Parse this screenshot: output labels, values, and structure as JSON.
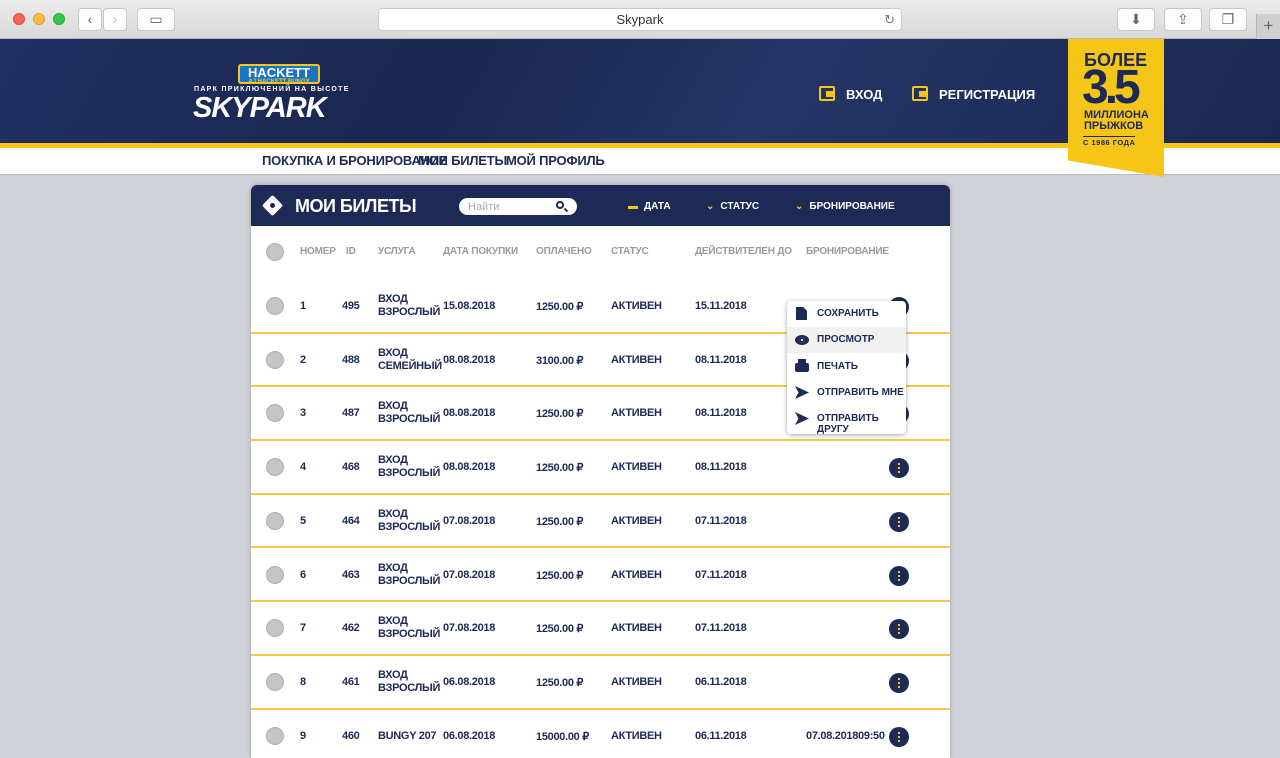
{
  "browser": {
    "tab_title": "Skypark"
  },
  "site": {
    "logo_badge_top": "HACKETT",
    "logo_badge_sub": "AJ HACKETT BUNGY",
    "logo_tagline": "ПАРК ПРИКЛЮЧЕНИЙ НА ВЫСОТЕ",
    "logo_name": "SKYPARK",
    "login_label": "ВХОД",
    "register_label": "РЕГИСТРАЦИЯ",
    "promo": {
      "line1": "БОЛЕЕ",
      "number": "3.5",
      "line2": "МИЛЛИОНА",
      "line3": "ПРЫЖКОВ",
      "line4": "С 1986 ГОДА"
    },
    "nav": [
      "ПОКУПКА И БРОНИРОВАНИЕ",
      "МОИ БИЛЕТЫ",
      "МОЙ ПРОФИЛЬ"
    ]
  },
  "panel": {
    "title": "МОИ БИЛЕТЫ",
    "search_placeholder": "Найти",
    "filters": [
      "ДАТА",
      "СТАТУС",
      "БРОНИРОВАНИЕ"
    ],
    "columns": [
      "НОМЕР",
      "ID",
      "УСЛУГА",
      "ДАТА ПОКУПКИ",
      "ОПЛАЧЕНО",
      "СТАТУС",
      "ДЕЙСТВИТЕЛЕН ДО",
      "БРОНИРОВАНИЕ"
    ],
    "rows": [
      {
        "num": "1",
        "id": "495",
        "service1": "ВХОД",
        "service2": "ВЗРОСЛЫЙ",
        "purchase_date": "15.08.2018",
        "paid": "1250.00 ₽",
        "status": "АКТИВЕН",
        "valid_until": "15.11.2018",
        "booking": ""
      },
      {
        "num": "2",
        "id": "488",
        "service1": "ВХОД",
        "service2": "СЕМЕЙНЫЙ",
        "purchase_date": "08.08.2018",
        "paid": "3100.00 ₽",
        "status": "АКТИВЕН",
        "valid_until": "08.11.2018",
        "booking": ""
      },
      {
        "num": "3",
        "id": "487",
        "service1": "ВХОД",
        "service2": "ВЗРОСЛЫЙ",
        "purchase_date": "08.08.2018",
        "paid": "1250.00 ₽",
        "status": "АКТИВЕН",
        "valid_until": "08.11.2018",
        "booking": ""
      },
      {
        "num": "4",
        "id": "468",
        "service1": "ВХОД",
        "service2": "ВЗРОСЛЫЙ",
        "purchase_date": "08.08.2018",
        "paid": "1250.00 ₽",
        "status": "АКТИВЕН",
        "valid_until": "08.11.2018",
        "booking": ""
      },
      {
        "num": "5",
        "id": "464",
        "service1": "ВХОД",
        "service2": "ВЗРОСЛЫЙ",
        "purchase_date": "07.08.2018",
        "paid": "1250.00 ₽",
        "status": "АКТИВЕН",
        "valid_until": "07.11.2018",
        "booking": ""
      },
      {
        "num": "6",
        "id": "463",
        "service1": "ВХОД",
        "service2": "ВЗРОСЛЫЙ",
        "purchase_date": "07.08.2018",
        "paid": "1250.00 ₽",
        "status": "АКТИВЕН",
        "valid_until": "07.11.2018",
        "booking": ""
      },
      {
        "num": "7",
        "id": "462",
        "service1": "ВХОД",
        "service2": "ВЗРОСЛЫЙ",
        "purchase_date": "07.08.2018",
        "paid": "1250.00 ₽",
        "status": "АКТИВЕН",
        "valid_until": "07.11.2018",
        "booking": ""
      },
      {
        "num": "8",
        "id": "461",
        "service1": "ВХОД",
        "service2": "ВЗРОСЛЫЙ",
        "purchase_date": "06.08.2018",
        "paid": "1250.00 ₽",
        "status": "АКТИВЕН",
        "valid_until": "06.11.2018",
        "booking": ""
      },
      {
        "num": "9",
        "id": "460",
        "service1": "BUNGY 207",
        "service2": "",
        "purchase_date": "06.08.2018",
        "paid": "15000.00 ₽",
        "status": "АКТИВЕН",
        "valid_until": "06.11.2018",
        "booking": "07.08.201809:50"
      }
    ]
  },
  "context_menu": {
    "items": [
      "СОХРАНИТЬ",
      "ПРОСМОТР",
      "ПЕЧАТЬ",
      "ОТПРАВИТЬ МНЕ",
      "ОТПРАВИТЬ ДРУГУ"
    ]
  },
  "colors": {
    "navy": "#1d2a55",
    "yellow": "#f5c518"
  }
}
